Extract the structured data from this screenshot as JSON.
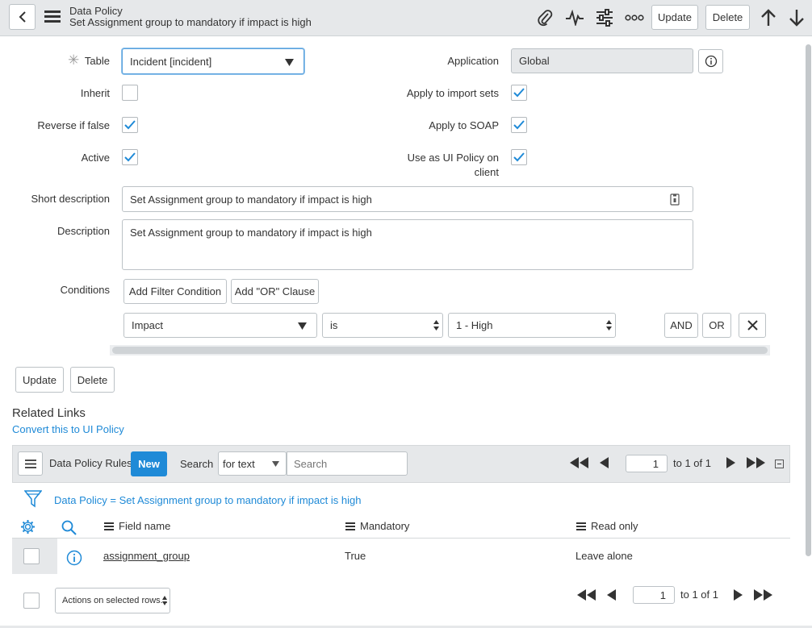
{
  "header": {
    "title": "Data Policy",
    "subtitle": "Set Assignment group to mandatory if impact is high",
    "update_label": "Update",
    "delete_label": "Delete"
  },
  "form": {
    "table_label": "Table",
    "table_value": "Incident [incident]",
    "application_label": "Application",
    "application_value": "Global",
    "inherit_label": "Inherit",
    "inherit_checked": false,
    "apply_import_label": "Apply to import sets",
    "apply_import_checked": true,
    "reverse_label": "Reverse if false",
    "reverse_checked": true,
    "apply_soap_label": "Apply to SOAP",
    "apply_soap_checked": true,
    "active_label": "Active",
    "active_checked": true,
    "ui_policy_label_1": "Use as UI Policy on",
    "ui_policy_label_2": "client",
    "ui_policy_checked": true,
    "short_desc_label": "Short description",
    "short_desc_value": "Set Assignment group to mandatory if impact is high",
    "desc_label": "Description",
    "desc_value": "Set Assignment group to mandatory if impact is high",
    "conditions_label": "Conditions",
    "add_filter_label": "Add Filter Condition",
    "add_or_label": "Add \"OR\" Clause",
    "cond_field": "Impact",
    "cond_operator": "is",
    "cond_value": "1 - High",
    "and_label": "AND",
    "or_label": "OR"
  },
  "actions": {
    "update_label": "Update",
    "delete_label": "Delete"
  },
  "related": {
    "title": "Related Links",
    "convert_link": "Convert this to UI Policy"
  },
  "list": {
    "title": "Data Policy Rules",
    "new_label": "New",
    "search_label": "Search",
    "search_field": "for text",
    "search_placeholder": "Search",
    "page_value": "1",
    "page_total": "to 1 of 1",
    "breadcrumb": "Data Policy = Set Assignment group to mandatory if impact is high",
    "columns": [
      "Field name",
      "Mandatory",
      "Read only"
    ],
    "rows": [
      {
        "field": "assignment_group",
        "mandatory": "True",
        "read_only": "Leave alone"
      }
    ],
    "actions_select": "Actions on selected rows...",
    "bottom_page_value": "1",
    "bottom_page_total": "to 1 of 1"
  },
  "colors": {
    "accent": "#1f8ad7",
    "header_bg": "#e6e8ea",
    "new_button": "#1f8ad7"
  }
}
